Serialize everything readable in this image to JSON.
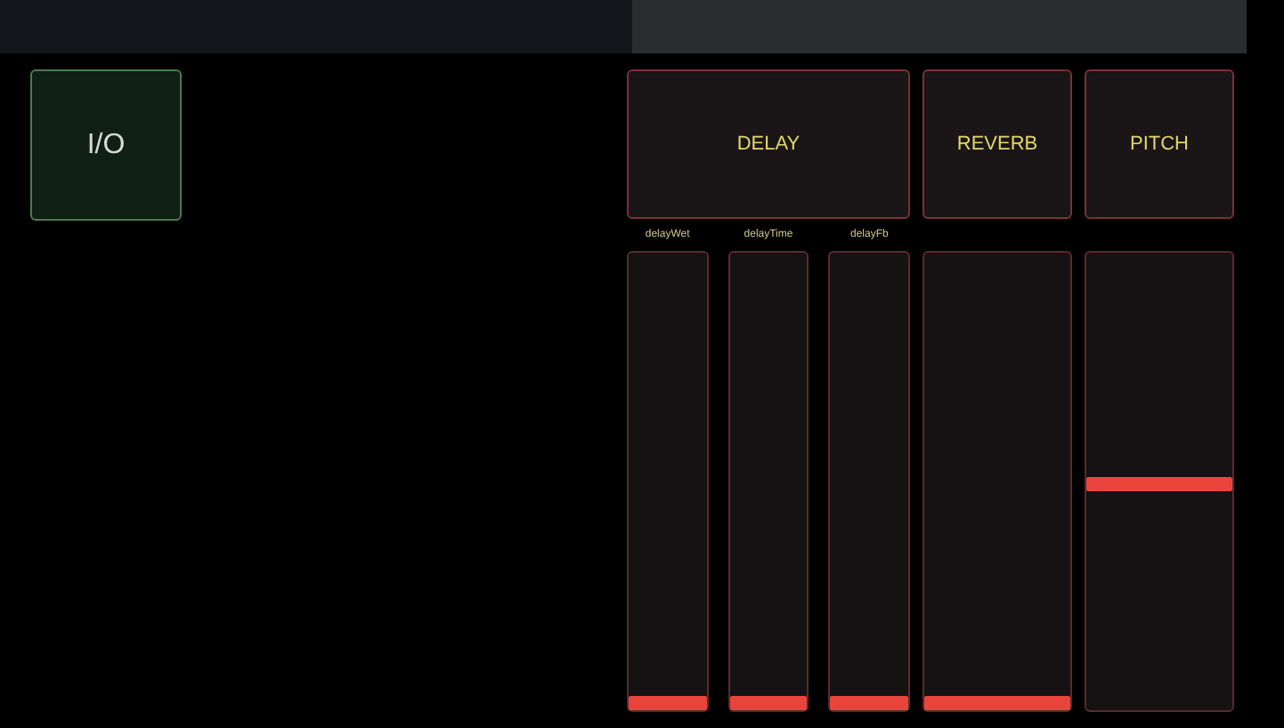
{
  "io_button": {
    "label": "I/O"
  },
  "effects": [
    {
      "label": "DELAY",
      "faders": [
        {
          "label": "delayWet",
          "level": 0
        },
        {
          "label": "delayTime",
          "level": 0
        },
        {
          "label": "delayFb",
          "level": 0
        }
      ]
    },
    {
      "label": "REVERB",
      "faders": [
        {
          "level": 0
        }
      ]
    },
    {
      "label": "PITCH",
      "faders": [
        {
          "level": 0.5
        }
      ]
    }
  ]
}
